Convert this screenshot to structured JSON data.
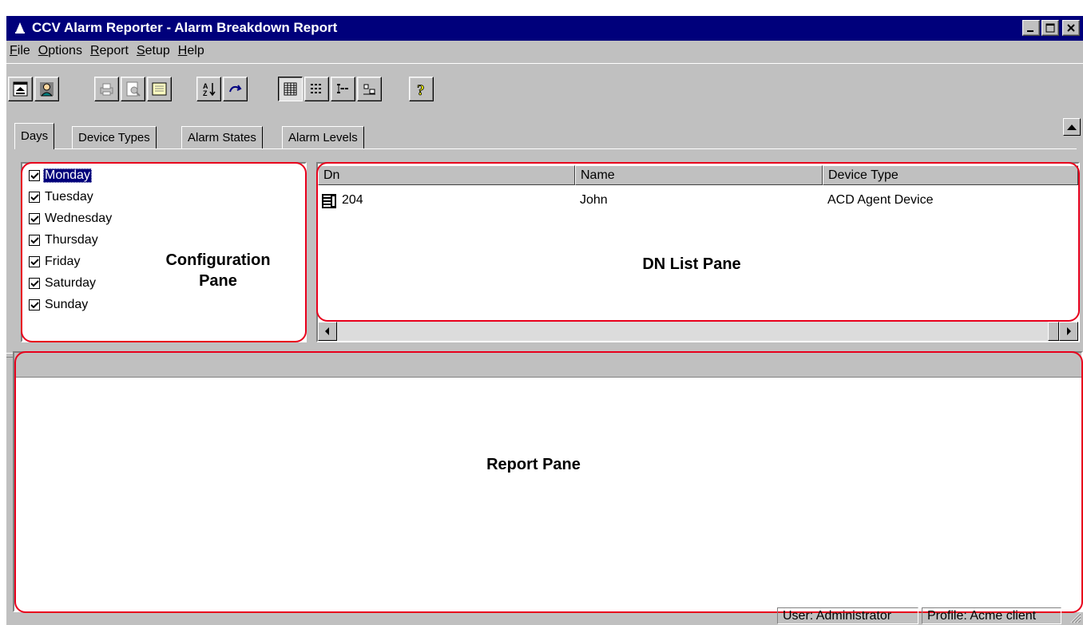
{
  "window": {
    "title": "CCV Alarm Reporter - Alarm Breakdown Report",
    "controls": {
      "minimize": "_",
      "maximize": "□",
      "close": "×"
    }
  },
  "menu": [
    {
      "accel": "F",
      "rest": "ile"
    },
    {
      "accel": "O",
      "rest": "ptions"
    },
    {
      "accel": "R",
      "rest": "eport"
    },
    {
      "accel": "S",
      "rest": "etup"
    },
    {
      "accel": "H",
      "rest": "elp"
    }
  ],
  "toolbar": {
    "icons": [
      "collapse-panes-icon",
      "user-profile-icon",
      "print-icon",
      "print-preview-icon",
      "notepad-icon",
      "sort-ascending-icon",
      "refresh-icon",
      "view-large-grid-icon",
      "view-list-icon",
      "view-tree-icon",
      "view-details-icon",
      "help-icon"
    ]
  },
  "tabs": [
    "Days",
    "Device Types",
    "Alarm States",
    "Alarm Levels"
  ],
  "active_tab": "Days",
  "config_pane": {
    "days": [
      {
        "label": "Monday",
        "checked": true,
        "selected": true
      },
      {
        "label": "Tuesday",
        "checked": true
      },
      {
        "label": "Wednesday",
        "checked": true
      },
      {
        "label": "Thursday",
        "checked": true
      },
      {
        "label": "Friday",
        "checked": true
      },
      {
        "label": "Saturday",
        "checked": true
      },
      {
        "label": "Sunday",
        "checked": true
      }
    ],
    "caption_line1": "Configuration",
    "caption_line2": "Pane"
  },
  "dn_list": {
    "columns": [
      "Dn",
      "Name",
      "Device Type"
    ],
    "rows": [
      {
        "dn": "204",
        "name": "John",
        "device_type": "ACD Agent Device",
        "icon": "agent-device-icon"
      }
    ],
    "caption": "DN List Pane"
  },
  "report_pane": {
    "caption": "Report Pane"
  },
  "status": {
    "user": "User: Administrator",
    "profile": "Profile: Acme client"
  },
  "colors": {
    "titlebar": "#00007b",
    "window_face": "#c0c0c0",
    "callout": "#e8001c",
    "selection": "#00007b"
  }
}
